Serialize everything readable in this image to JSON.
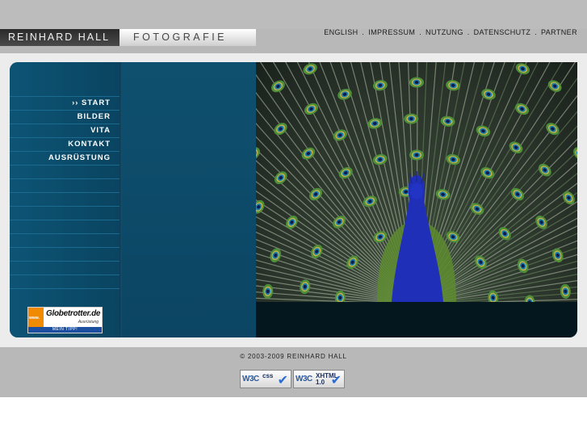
{
  "header": {
    "logo_name": "REINHARD HALL",
    "logo_section": "FOTOGRAFIE",
    "links": [
      {
        "label": "ENGLISH"
      },
      {
        "label": "IMPRESSUM"
      },
      {
        "label": "NUTZUNG"
      },
      {
        "label": "DATENSCHUTZ"
      },
      {
        "label": "PARTNER"
      }
    ],
    "separator": "."
  },
  "nav": {
    "items": [
      {
        "label": "›› START"
      },
      {
        "label": "BILDER"
      },
      {
        "label": "VITA"
      },
      {
        "label": "KONTAKT"
      },
      {
        "label": "AUSRÜSTUNG"
      }
    ],
    "empty_rows": 10
  },
  "badge": {
    "www": "www.",
    "logo": "Globetrotter.de",
    "sub": "Ausrüstung",
    "bar": "MEIN TIPP!"
  },
  "photo": {
    "subject": "peacock-photo"
  },
  "footer": {
    "copyright": "© 2003-2009 REINHARD HALL",
    "badges": [
      {
        "w3": "W3C",
        "kind": "css"
      },
      {
        "w3": "W3C",
        "kind": "XHTML 1.0"
      }
    ]
  },
  "colors": {
    "panel": "#0c4c6a",
    "peacock_body": "#1f2fb8",
    "feather_green": "#4f8f3a"
  }
}
